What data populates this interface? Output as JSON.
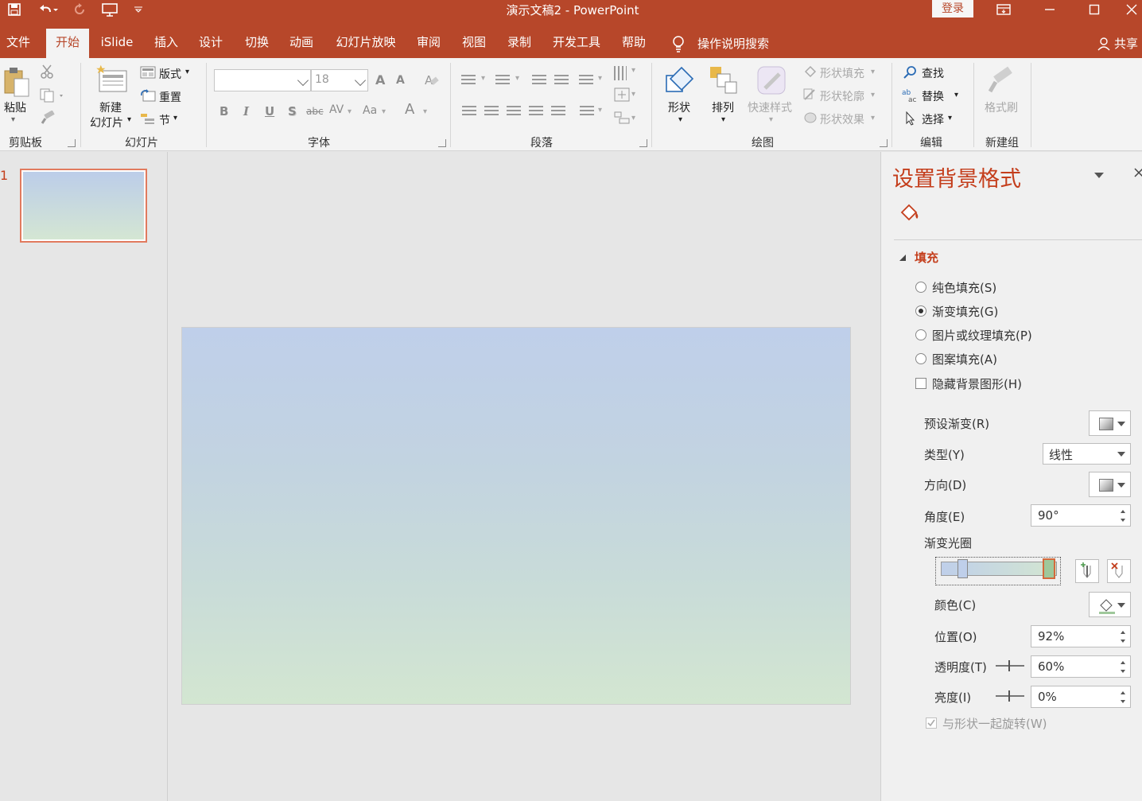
{
  "app": {
    "title": "演示文稿2  -  PowerPoint",
    "login_label": "登录",
    "accent": "#b7472a"
  },
  "qat": [
    "save-icon",
    "undo-icon",
    "redo-icon",
    "present-icon",
    "customize-icon"
  ],
  "tabs": {
    "file": "文件",
    "home": "开始",
    "islide": "iSlide",
    "insert": "插入",
    "design": "设计",
    "transitions": "切换",
    "animations": "动画",
    "slideshow": "幻灯片放映",
    "review": "审阅",
    "view": "视图",
    "record": "录制",
    "developer": "开发工具",
    "help": "帮助",
    "tell_me": "操作说明搜索",
    "share": "共享"
  },
  "ribbon": {
    "clipboard": {
      "paste": "粘贴",
      "label": "剪贴板"
    },
    "slides": {
      "new_slide_1": "新建",
      "new_slide_2": "幻灯片",
      "layout": "版式",
      "reset": "重置",
      "section": "节",
      "label": "幻灯片"
    },
    "font": {
      "font_name": "",
      "font_size": "18",
      "bold": "B",
      "italic": "I",
      "underline": "U",
      "shadow": "S",
      "strike": "abc",
      "spacing": "AV",
      "case": "Aa",
      "color": "A",
      "grow": "A",
      "shrink": "A",
      "label": "字体"
    },
    "paragraph": {
      "label": "段落"
    },
    "drawing": {
      "shapes": "形状",
      "arrange": "排列",
      "quick_styles": "快速样式",
      "shape_fill": "形状填充",
      "shape_outline": "形状轮廓",
      "shape_effects": "形状效果",
      "label": "绘图"
    },
    "editing": {
      "find": "查找",
      "replace": "替换",
      "select": "选择",
      "label": "编辑"
    },
    "new_group": {
      "format_painter": "格式刷",
      "label": "新建组"
    }
  },
  "thumbnails": {
    "slide_number": "1"
  },
  "format_pane": {
    "title": "设置背景格式",
    "section": "填充",
    "fill_options": [
      {
        "label": "纯色填充(S)",
        "selected": false
      },
      {
        "label": "渐变填充(G)",
        "selected": true
      },
      {
        "label": "图片或纹理填充(P)",
        "selected": false
      },
      {
        "label": "图案填充(A)",
        "selected": false
      }
    ],
    "hide_bg": {
      "label": "隐藏背景图形(H)",
      "checked": false
    },
    "preset_label": "预设渐变(R)",
    "type_label": "类型(Y)",
    "type_value": "线性",
    "direction_label": "方向(D)",
    "angle_label": "角度(E)",
    "angle_value": "90°",
    "stops_label": "渐变光圈",
    "color_label": "颜色(C)",
    "position_label": "位置(O)",
    "position_value": "92%",
    "transparency_label": "透明度(T)",
    "transparency_value": "60%",
    "brightness_label": "亮度(I)",
    "brightness_value": "0%",
    "rotate": {
      "label": "与形状一起旋转(W)",
      "checked": true
    },
    "gradient_top": "#bfcfea",
    "gradient_bottom": "#d3e6d1"
  }
}
